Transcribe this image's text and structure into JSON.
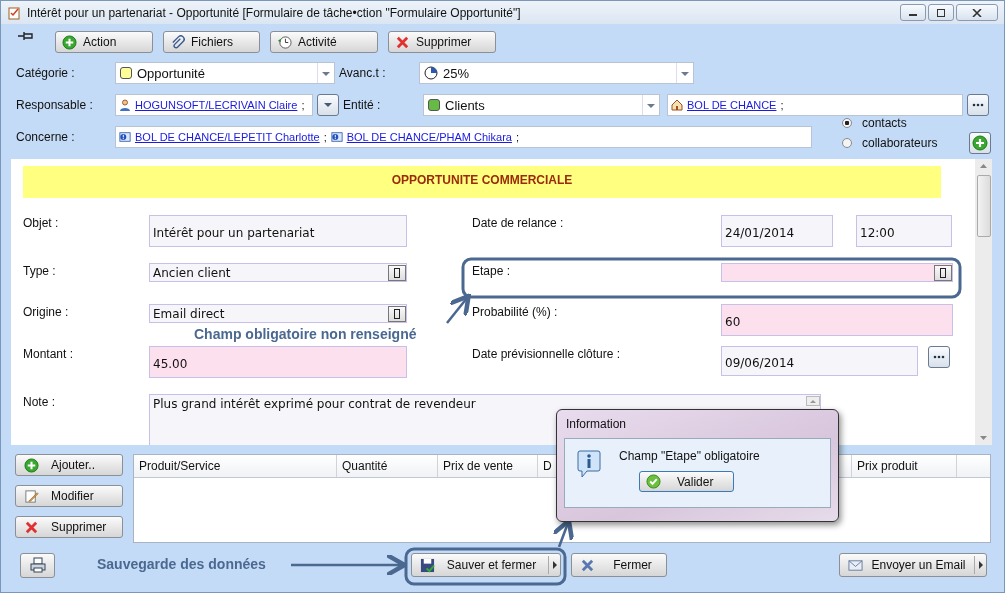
{
  "window": {
    "title": "Intérêt pour un partenariat - Opportunité [Formulaire de tâche•ction \"Formulaire Opportunité\"]"
  },
  "toolbar": [
    {
      "label": "Action",
      "kind": "plus"
    },
    {
      "label": "Fichiers",
      "kind": "clip"
    },
    {
      "label": "Activité",
      "kind": "clock"
    },
    {
      "label": "Supprimer",
      "kind": "cross"
    }
  ],
  "category": {
    "label": "Catégorie :",
    "value": "Opportunité",
    "color": "#ffff99"
  },
  "progress": {
    "label": "Avanc.t :",
    "value": "25%"
  },
  "responsible": {
    "label": "Responsable :",
    "links": [
      {
        "text": "HOGUNSOFT/LECRIVAIN Claire",
        "separator": ";"
      }
    ]
  },
  "entity": {
    "label": "Entité :",
    "value": "Clients",
    "color": "#66bb44"
  },
  "company": {
    "links": [
      {
        "text": "BOL DE CHANCE",
        "separator": ";"
      }
    ]
  },
  "concerns": {
    "label": "Concerne :",
    "links": [
      {
        "text": "BOL DE CHANCE/LEPETIT Charlotte",
        "separator": ";"
      },
      {
        "text": "BOL DE CHANCE/PHAM Chikara",
        "separator": ";"
      }
    ]
  },
  "recipient_options": [
    {
      "label": "contacts",
      "selected": true
    },
    {
      "label": "collaborateurs",
      "selected": false
    }
  ],
  "form": {
    "title": "OPPORTUNITE COMMERCIALE",
    "rows": [
      {
        "left": {
          "label": "Objet :",
          "kind": "text",
          "value": "Intérêt pour un partenariat",
          "required": false
        },
        "right": {
          "label": "Date de relance :",
          "kind": "datetime",
          "values": [
            "24/01/2014",
            "12:00"
          ],
          "required": false
        }
      },
      {
        "left": {
          "label": "Type :",
          "kind": "select",
          "value": "Ancien client",
          "required": false
        },
        "right": {
          "label": "Etape :",
          "kind": "select",
          "required": true
        }
      },
      {
        "left": {
          "label": "Origine :",
          "kind": "select",
          "value": "Email direct",
          "required": false
        },
        "right": {
          "label": "Probabilité (%) :",
          "kind": "text",
          "value": "60",
          "required": true
        }
      },
      {
        "left": {
          "label": "Montant :",
          "kind": "text",
          "value": "45.00",
          "required": true
        },
        "right": {
          "label": "Date prévisionnelle clôture :",
          "kind": "date",
          "value": "09/06/2014",
          "required": false
        }
      },
      {
        "left": {
          "label": "Note :",
          "kind": "textarea",
          "value": "Plus grand intérêt exprimé pour contrat de revendeur",
          "required": false
        }
      }
    ]
  },
  "products": {
    "buttons": [
      {
        "label": "Ajouter..",
        "kind": "plus"
      },
      {
        "label": "Modifier",
        "kind": "edit"
      },
      {
        "label": "Supprimer",
        "kind": "cross"
      }
    ],
    "columns": [
      "Produit/Service",
      "Quantité",
      "Prix de vente",
      "D",
      "Prix produit"
    ]
  },
  "footer": {
    "buttons": [
      {
        "kind": "print"
      },
      {
        "kind": "save",
        "label": "Sauver et fermer",
        "split": true
      },
      {
        "kind": "cross",
        "label": "Fermer",
        "split": false
      },
      {
        "kind": "mail",
        "label": "Envoyer un Email",
        "split": true
      }
    ]
  },
  "dialog": {
    "title": "Information",
    "message": "Champ \"Etape\" obligatoire",
    "button": "Valider"
  },
  "annotations": [
    {
      "text": "Champ obligatoire non renseigné"
    },
    {
      "text": "Sauvegarde des données"
    }
  ]
}
